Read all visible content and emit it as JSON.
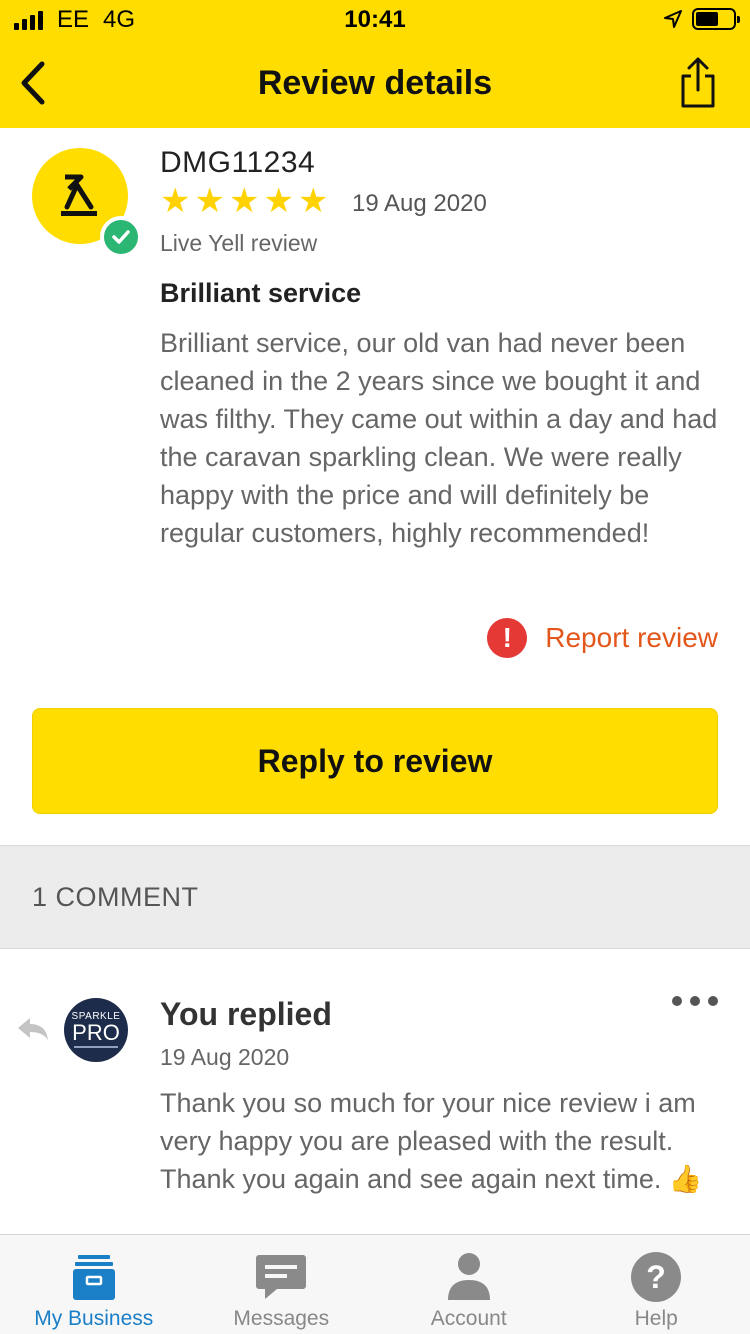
{
  "status_bar": {
    "carrier": "EE",
    "network": "4G",
    "time": "10:41"
  },
  "nav": {
    "title": "Review details",
    "back_icon": "chevron-left-icon",
    "share_icon": "share-icon"
  },
  "review": {
    "reviewer": "DMG11234",
    "rating": 5,
    "stars": "★★★★★",
    "date": "19 Aug 2020",
    "source": "Live Yell review",
    "title": "Brilliant service",
    "body": "Brilliant service, our old van had never been cleaned in the 2 years since we bought it and was filthy. They came out within a day and had the caravan sparkling clean. We were really happy with the price and will definitely be regular customers, highly recommended!",
    "report_icon": "!",
    "report_label": "Report review"
  },
  "reply_button": {
    "label": "Reply to review"
  },
  "comments": {
    "header": "1 COMMENT",
    "items": [
      {
        "author": "You replied",
        "date": "19 Aug 2020",
        "body": "Thank you so much for your nice review i am very happy you are pleased with the result. Thank you again and see again next time. 👍",
        "avatar_top": "SPARKLE",
        "avatar_main": "PRO"
      }
    ]
  },
  "tabs": [
    {
      "label": "My Business",
      "icon": "business-icon",
      "active": true
    },
    {
      "label": "Messages",
      "icon": "messages-icon",
      "active": false
    },
    {
      "label": "Account",
      "icon": "account-icon",
      "active": false
    },
    {
      "label": "Help",
      "icon": "help-icon",
      "active": false
    }
  ],
  "colors": {
    "brand_yellow": "#ffdd00",
    "verified_green": "#2bb673",
    "report_red": "#e53935",
    "report_text": "#e3571c",
    "active_tab": "#1a7fc7"
  }
}
